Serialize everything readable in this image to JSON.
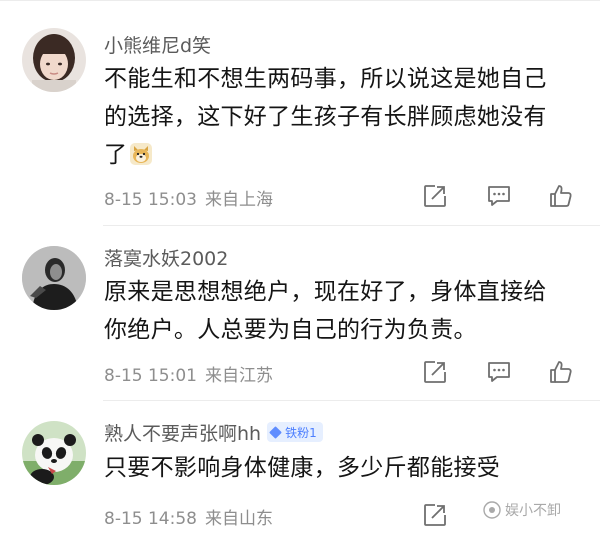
{
  "comments": [
    {
      "username": "小熊维尼d笑",
      "badge": "",
      "lines": [
        "不能生和不想生两码事，所以说这是她自己",
        "的选择，这下好了生孩子有长胖顾虑她没有",
        "了"
      ],
      "emoji": "doge-emoji",
      "time": "8-15 15:03",
      "location": "来自上海",
      "avatar": "woman-portrait"
    },
    {
      "username": "落寞水妖2002",
      "badge": "",
      "lines": [
        "原来是思想想绝户，现在好了，身体直接给",
        "你绝户。人总要为自己的行为负责。"
      ],
      "time": "8-15 15:01",
      "location": "来自江苏",
      "avatar": "dark-portrait"
    },
    {
      "username": "熟人不要声张啊hh",
      "badge": "铁粉1",
      "lines": [
        "只要不影响身体健康，多少斤都能接受"
      ],
      "time": "8-15 14:58",
      "location": "来自山东",
      "avatar": "panda"
    }
  ],
  "watermark": {
    "text": "娱小不卸"
  },
  "icons": [
    "share-icon",
    "comment-icon",
    "like-icon",
    "badge-diamond-icon"
  ],
  "colors": {
    "meta_text": "#8e8e8e",
    "username": "#5b5b5b",
    "badge_bg": "#e6efff",
    "badge_text": "#4d7fff"
  }
}
